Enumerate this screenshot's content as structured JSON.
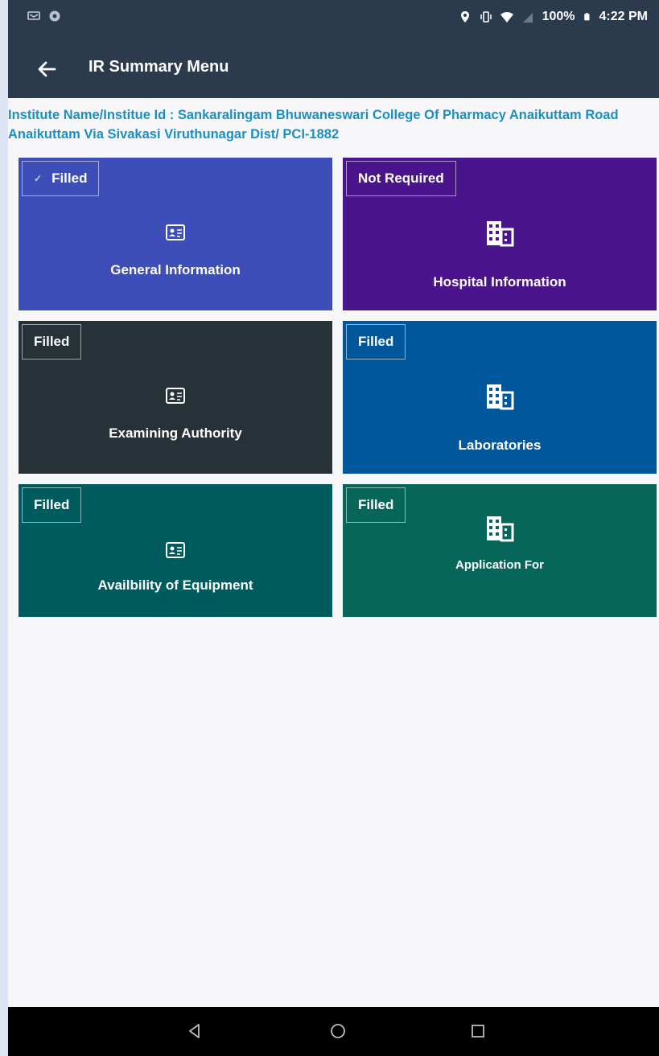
{
  "status_bar": {
    "battery": "100%",
    "time": "4:22 PM",
    "left_icons": [
      "notification-icon",
      "app-icon"
    ],
    "right_icons": [
      "location-icon",
      "vibrate-icon",
      "wifi-icon",
      "signal-icon",
      "battery-icon"
    ]
  },
  "app_bar": {
    "title": "IR Summary Menu",
    "back_icon": "arrow-left-icon"
  },
  "institute": {
    "text": "Institute Name/Institue Id : Sankaralingam Bhuwaneswari College Of Pharmacy Anaikuttam Road Anaikuttam Via Sivakasi Viruthunagar Dist/ PCI-1882"
  },
  "tiles": [
    {
      "status": "Filled",
      "label": "General Information",
      "icon": "id-card-icon",
      "color": "#3e4eb8",
      "checked": true
    },
    {
      "status": "Not Required",
      "label": "Hospital Information",
      "icon": "building-icon",
      "color": "#4a148c"
    },
    {
      "status": "Filled",
      "label": "Examining Authority",
      "icon": "id-card-icon",
      "color": "#263238"
    },
    {
      "status": "Filled",
      "label": "Laboratories",
      "icon": "building-icon",
      "color": "#01579b"
    },
    {
      "status": "Filled",
      "label": "Availbility of Equipment",
      "icon": "id-card-icon",
      "color": "#005b5e"
    },
    {
      "status": "Filled",
      "label": "Application For",
      "icon": "building-icon",
      "color": "#07665a"
    }
  ],
  "colors": {
    "header_bg": "#2b3a4d",
    "institute_text": "#1a8fc4",
    "page_bg": "#f7f7f9",
    "outer_bg": "#dde4f3"
  },
  "nav_bar": {
    "icons": [
      "back-triangle-icon",
      "home-circle-icon",
      "recents-square-icon"
    ]
  }
}
